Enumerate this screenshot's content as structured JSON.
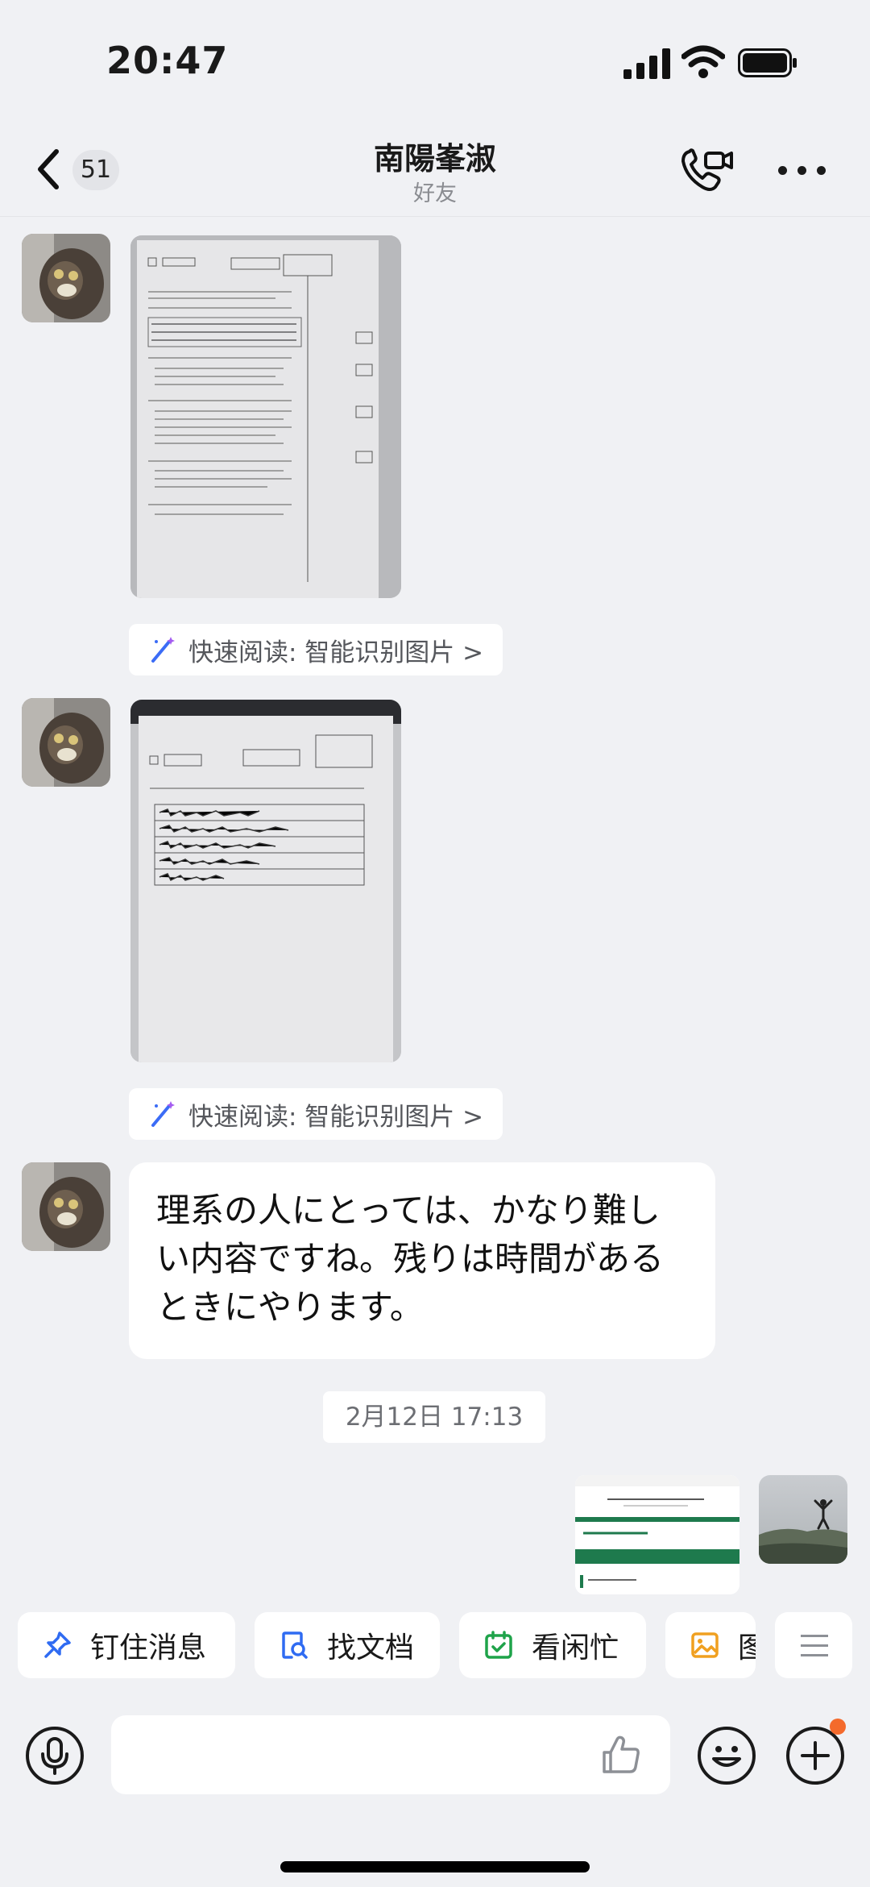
{
  "status_bar": {
    "time": "20:47"
  },
  "nav": {
    "unread_count": "51",
    "title": "南陽峯淑",
    "subtitle": "好友"
  },
  "messages": {
    "ocr_chip_label": "快速阅读: 智能识别图片 >",
    "text_message": "理系の人にとっては、かなり難しい内容ですね。残りは時間があるときにやります。",
    "timestamp": "2月12日 17:13"
  },
  "quick_actions": [
    {
      "label": "钉住消息",
      "icon": "pin-icon"
    },
    {
      "label": "找文档",
      "icon": "doc-search-icon"
    },
    {
      "label": "看闲忙",
      "icon": "calendar-check-icon"
    },
    {
      "label": "图",
      "icon": "image-icon"
    }
  ],
  "colors": {
    "background": "#f0f1f4",
    "bubble": "#ffffff",
    "badge": "#e3e4e8",
    "notification_dot": "#f46a2c",
    "ocr_wand": "#3b6cf6",
    "calendar_green": "#1fa34a",
    "image_orange": "#f0a020"
  }
}
